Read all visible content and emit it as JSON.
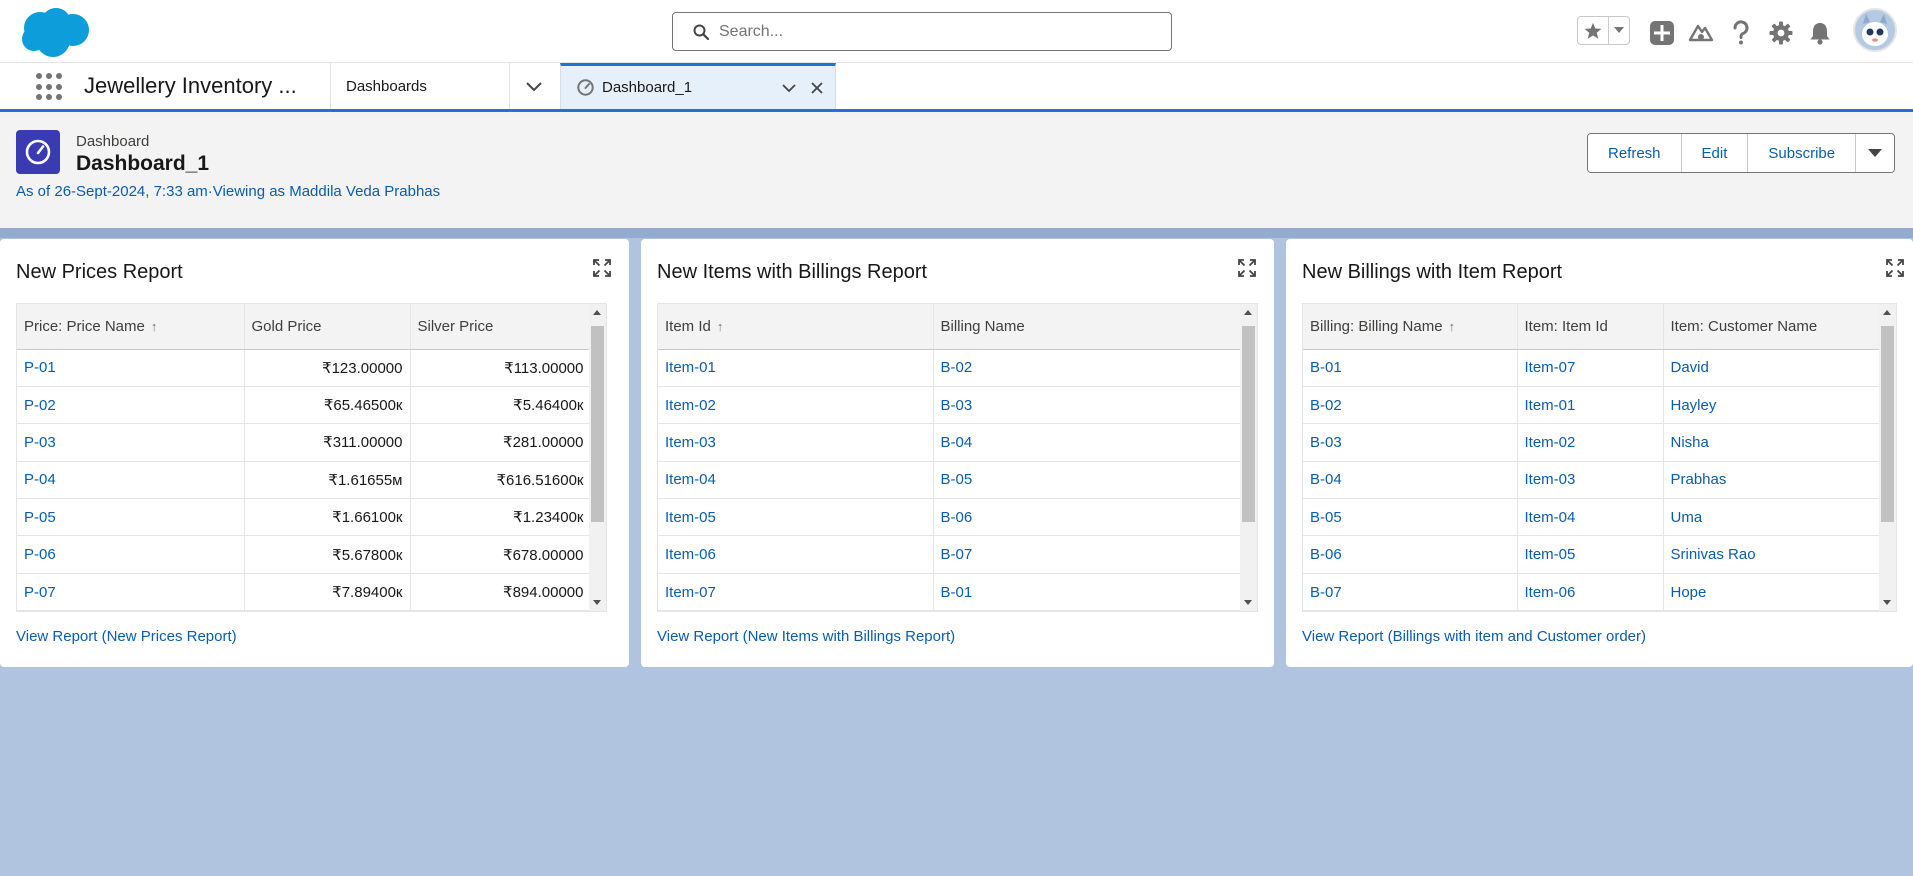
{
  "header": {
    "search_placeholder": "Search..."
  },
  "nav": {
    "app_name": "Jewellery Inventory ...",
    "item_label": "Dashboards",
    "active_tab": "Dashboard_1"
  },
  "page": {
    "object_label": "Dashboard",
    "title": "Dashboard_1",
    "as_of": "As of 26-Sept-2024, 7:33 am·Viewing as Maddila Veda Prabhas",
    "buttons": {
      "refresh": "Refresh",
      "edit": "Edit",
      "subscribe": "Subscribe"
    }
  },
  "cards": [
    {
      "title": "New Prices Report",
      "columns": [
        "Price: Price Name",
        "Gold Price",
        "Silver Price"
      ],
      "rows": [
        [
          "P-01",
          "₹123.00000",
          "₹113.00000"
        ],
        [
          "P-02",
          "₹65.46500к",
          "₹5.46400к"
        ],
        [
          "P-03",
          "₹311.00000",
          "₹281.00000"
        ],
        [
          "P-04",
          "₹1.61655м",
          "₹616.51600к"
        ],
        [
          "P-05",
          "₹1.66100к",
          "₹1.23400к"
        ],
        [
          "P-06",
          "₹5.67800к",
          "₹678.00000"
        ],
        [
          "P-07",
          "₹7.89400к",
          "₹894.00000"
        ]
      ],
      "view_link": "View Report (New Prices Report)"
    },
    {
      "title": "New Items with Billings Report",
      "columns": [
        "Item Id",
        "Billing Name"
      ],
      "rows": [
        [
          "Item-01",
          "B-02"
        ],
        [
          "Item-02",
          "B-03"
        ],
        [
          "Item-03",
          "B-04"
        ],
        [
          "Item-04",
          "B-05"
        ],
        [
          "Item-05",
          "B-06"
        ],
        [
          "Item-06",
          "B-07"
        ],
        [
          "Item-07",
          "B-01"
        ]
      ],
      "view_link": "View Report (New Items with Billings Report)"
    },
    {
      "title": "New Billings with Item Report",
      "columns": [
        "Billing: Billing Name",
        "Item: Item Id",
        "Item: Customer Name"
      ],
      "rows": [
        [
          "B-01",
          "Item-07",
          "David"
        ],
        [
          "B-02",
          "Item-01",
          "Hayley"
        ],
        [
          "B-03",
          "Item-02",
          "Nisha"
        ],
        [
          "B-04",
          "Item-03",
          "Prabhas"
        ],
        [
          "B-05",
          "Item-04",
          "Uma"
        ],
        [
          "B-06",
          "Item-05",
          "Srinivas Rao"
        ],
        [
          "B-07",
          "Item-06",
          "Hope"
        ]
      ],
      "view_link": "View Report (Billings with item and Customer order)"
    }
  ]
}
